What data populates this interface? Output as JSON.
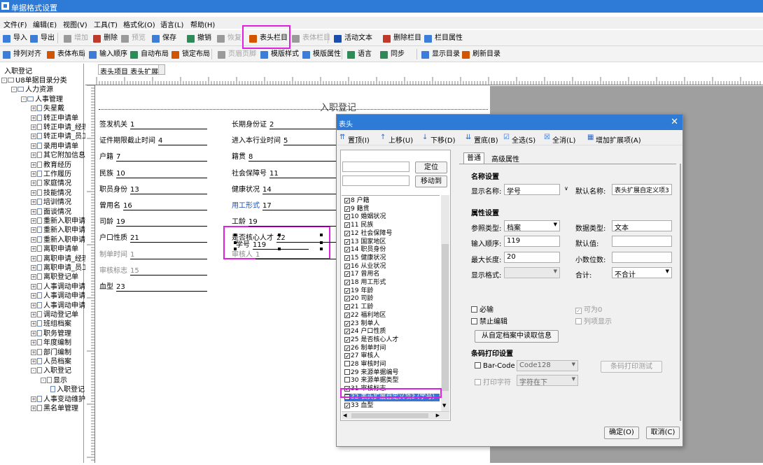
{
  "window": {
    "title": "单据格式设置"
  },
  "menu": [
    "文件(F)",
    "编辑(E)",
    "视图(V)",
    "工具(T)",
    "格式化(O)",
    "语言(L)",
    "帮助(H)"
  ],
  "toolbar1": [
    {
      "label": "导入",
      "icon": "import-icon",
      "color": "#3b7dd8",
      "enabled": true
    },
    {
      "label": "导出",
      "icon": "export-icon",
      "color": "#3b7dd8",
      "enabled": true
    },
    {
      "label": "增加",
      "icon": "add-icon",
      "color": "#9a9a9a",
      "enabled": false
    },
    {
      "label": "删除",
      "icon": "delete-icon",
      "color": "#c0392b",
      "enabled": true
    },
    {
      "label": "预览",
      "icon": "preview-icon",
      "color": "#9a9a9a",
      "enabled": false
    },
    {
      "label": "保存",
      "icon": "save-icon",
      "color": "#3b7dd8",
      "enabled": true
    },
    {
      "label": "撤销",
      "icon": "undo-icon",
      "color": "#2e8b57",
      "enabled": true
    },
    {
      "label": "恢复",
      "icon": "redo-icon",
      "color": "#9a9a9a",
      "enabled": false
    },
    {
      "label": "表头栏目",
      "icon": "header-column-icon",
      "color": "#d35400",
      "enabled": true
    },
    {
      "label": "表体栏目",
      "icon": "body-column-icon",
      "color": "#9a9a9a",
      "enabled": false
    },
    {
      "label": "活动文本",
      "icon": "active-text-icon",
      "color": "#1a4fb0",
      "enabled": true
    },
    {
      "label": "删除栏目",
      "icon": "delete-column-icon",
      "color": "#c0392b",
      "enabled": true
    },
    {
      "label": "栏目属性",
      "icon": "column-property-icon",
      "color": "#3b7dd8",
      "enabled": true
    }
  ],
  "toolbar2": [
    {
      "label": "排列对齐",
      "icon": "align-icon",
      "color": "#3b7dd8",
      "enabled": true
    },
    {
      "label": "表体布局",
      "icon": "body-layout-icon",
      "color": "#d35400",
      "enabled": true
    },
    {
      "label": "输入顺序",
      "icon": "input-order-icon",
      "color": "#3b7dd8",
      "enabled": true
    },
    {
      "label": "自动布局",
      "icon": "auto-layout-icon",
      "color": "#2e8b57",
      "enabled": true
    },
    {
      "label": "锁定布局",
      "icon": "lock-layout-icon",
      "color": "#d35400",
      "enabled": true
    },
    {
      "label": "页眉页脚",
      "icon": "header-footer-icon",
      "color": "#9a9a9a",
      "enabled": false
    },
    {
      "label": "模版样式",
      "icon": "template-style-icon",
      "color": "#3b7dd8",
      "enabled": true
    },
    {
      "label": "模版属性",
      "icon": "template-property-icon",
      "color": "#3b7dd8",
      "enabled": true
    },
    {
      "label": "语言",
      "icon": "language-icon",
      "color": "#2e8b57",
      "enabled": true
    },
    {
      "label": "同步",
      "icon": "sync-icon",
      "color": "#2e8b57",
      "enabled": true
    },
    {
      "label": "显示目录",
      "icon": "show-catalog-icon",
      "color": "#3b7dd8",
      "enabled": true
    },
    {
      "label": "刷新目录",
      "icon": "refresh-catalog-icon",
      "color": "#d35400",
      "enabled": true
    }
  ],
  "left_pane": {
    "title": "入职登记",
    "tree": [
      {
        "label": "U8单据目录分类",
        "depth": 0,
        "type": "folder",
        "exp": "-"
      },
      {
        "label": "人力资源",
        "depth": 1,
        "type": "folder",
        "exp": "-"
      },
      {
        "label": "人事管理",
        "depth": 2,
        "type": "folder",
        "exp": "-"
      },
      {
        "label": "失星戴",
        "depth": 3,
        "type": "doc",
        "exp": "+"
      },
      {
        "label": "转正申请单",
        "depth": 3,
        "type": "doc",
        "exp": "+"
      },
      {
        "label": "转正申请_经理",
        "depth": 3,
        "type": "doc",
        "exp": "+"
      },
      {
        "label": "转正申请_员工",
        "depth": 3,
        "type": "doc",
        "exp": "+"
      },
      {
        "label": "录用申请单",
        "depth": 3,
        "type": "doc",
        "exp": "+"
      },
      {
        "label": "其它附加信息",
        "depth": 3,
        "type": "doc",
        "exp": "+"
      },
      {
        "label": "教育经历",
        "depth": 3,
        "type": "doc",
        "exp": "+"
      },
      {
        "label": "工作履历",
        "depth": 3,
        "type": "doc",
        "exp": "+"
      },
      {
        "label": "家庭情况",
        "depth": 3,
        "type": "doc",
        "exp": "+"
      },
      {
        "label": "技能情况",
        "depth": 3,
        "type": "doc",
        "exp": "+"
      },
      {
        "label": "培训情况",
        "depth": 3,
        "type": "doc",
        "exp": "+"
      },
      {
        "label": "面谈情况",
        "depth": 3,
        "type": "doc",
        "exp": "+"
      },
      {
        "label": "重新入职申请单",
        "depth": 3,
        "type": "doc",
        "exp": "+"
      },
      {
        "label": "重新入职申请单",
        "depth": 3,
        "type": "doc",
        "exp": "+"
      },
      {
        "label": "重新入职申请单",
        "depth": 3,
        "type": "doc",
        "exp": "+"
      },
      {
        "label": "离职申请单",
        "depth": 3,
        "type": "doc",
        "exp": "+"
      },
      {
        "label": "离职申请_经理",
        "depth": 3,
        "type": "doc",
        "exp": "+"
      },
      {
        "label": "离职申请_员工",
        "depth": 3,
        "type": "doc",
        "exp": "+"
      },
      {
        "label": "离职登记单",
        "depth": 3,
        "type": "doc",
        "exp": "+"
      },
      {
        "label": "人事调动申请单",
        "depth": 3,
        "type": "doc",
        "exp": "+"
      },
      {
        "label": "人事调动申请单",
        "depth": 3,
        "type": "doc",
        "exp": "+"
      },
      {
        "label": "人事调动申请单",
        "depth": 3,
        "type": "doc",
        "exp": "+"
      },
      {
        "label": "调动登记单",
        "depth": 3,
        "type": "doc",
        "exp": "+"
      },
      {
        "label": "班组档案",
        "depth": 3,
        "type": "doc",
        "exp": "+"
      },
      {
        "label": "职务管理",
        "depth": 3,
        "type": "doc",
        "exp": "+"
      },
      {
        "label": "年度编制",
        "depth": 3,
        "type": "doc",
        "exp": "+"
      },
      {
        "label": "部门编制",
        "depth": 3,
        "type": "doc",
        "exp": "+"
      },
      {
        "label": "人员档案",
        "depth": 3,
        "type": "doc",
        "exp": "+"
      },
      {
        "label": "入职登记",
        "depth": 3,
        "type": "doc",
        "exp": "-"
      },
      {
        "label": "显示",
        "depth": 4,
        "type": "doc",
        "exp": "-"
      },
      {
        "label": "入职登记",
        "depth": 5,
        "type": "doc",
        "exp": ""
      },
      {
        "label": "人事变动维护",
        "depth": 3,
        "type": "doc",
        "exp": "+"
      },
      {
        "label": "黑名单管理",
        "depth": 3,
        "type": "doc",
        "exp": "+"
      }
    ]
  },
  "header_select": "表头项目 表头扩展自定",
  "doc": {
    "title": "入职登记",
    "fields": [
      {
        "label": "签发机关",
        "value": "1",
        "col": 0,
        "row": 0
      },
      {
        "label": "证件期限截止时间",
        "value": "4",
        "col": 0,
        "row": 1
      },
      {
        "label": "户籍",
        "value": "7",
        "col": 0,
        "row": 2
      },
      {
        "label": "民族",
        "value": "10",
        "col": 0,
        "row": 3
      },
      {
        "label": "职员身份",
        "value": "13",
        "col": 0,
        "row": 4
      },
      {
        "label": "曾用名",
        "value": "16",
        "col": 0,
        "row": 5
      },
      {
        "label": "司龄",
        "value": "19",
        "col": 0,
        "row": 6
      },
      {
        "label": "户口性质",
        "value": "21",
        "col": 0,
        "row": 7
      },
      {
        "label": "制单时间",
        "value": "1",
        "col": 0,
        "row": 8,
        "dim": true
      },
      {
        "label": "审核标志",
        "value": "15",
        "col": 0,
        "row": 9,
        "dim": true
      },
      {
        "label": "血型",
        "value": "23",
        "col": 0,
        "row": 10
      },
      {
        "label": "长期身份证",
        "value": "2",
        "col": 1,
        "row": 0
      },
      {
        "label": "进入本行业时间",
        "value": "5",
        "col": 1,
        "row": 1
      },
      {
        "label": "籍贯",
        "value": "8",
        "col": 1,
        "row": 2
      },
      {
        "label": "社会保障号",
        "value": "11",
        "col": 1,
        "row": 3
      },
      {
        "label": "健康状况",
        "value": "14",
        "col": 1,
        "row": 4
      },
      {
        "label": "用工形式",
        "value": "17",
        "col": 1,
        "row": 5,
        "blue": true
      },
      {
        "label": "工龄",
        "value": "19",
        "col": 1,
        "row": 6
      },
      {
        "label": "是否核心人才",
        "value": "22",
        "col": 1,
        "row": 7
      },
      {
        "label": "审核人",
        "value": "1",
        "col": 1,
        "row": 8,
        "dim": true
      }
    ],
    "selected_field": {
      "label": "学号",
      "value": "119"
    }
  },
  "dialog": {
    "title": "表头",
    "toolbar": [
      {
        "label": "置顶(I)",
        "icon": "top-icon",
        "glyph": "⇈"
      },
      {
        "label": "上移(U)",
        "icon": "up-icon",
        "glyph": "↑"
      },
      {
        "label": "下移(D)",
        "icon": "down-icon",
        "glyph": "↓"
      },
      {
        "label": "置底(B)",
        "icon": "bottom-icon",
        "glyph": "⇊"
      },
      {
        "label": "全选(S)",
        "icon": "select-all-icon",
        "glyph": "☑"
      },
      {
        "label": "全消(L)",
        "icon": "clear-all-icon",
        "glyph": "☒"
      },
      {
        "label": "增加扩展项(A)",
        "icon": "add-extension-icon",
        "glyph": "▦"
      }
    ],
    "locate_btn": "定位",
    "move_btn": "移动到",
    "list": [
      {
        "label": "8 户籍",
        "checked": true
      },
      {
        "label": "9 籍贯",
        "checked": true
      },
      {
        "label": "10 婚姻状况",
        "checked": true
      },
      {
        "label": "11 民族",
        "checked": true
      },
      {
        "label": "12 社会保障号",
        "checked": true
      },
      {
        "label": "13 国家地区",
        "checked": true
      },
      {
        "label": "14 职员身份",
        "checked": true
      },
      {
        "label": "15 健康状况",
        "checked": true
      },
      {
        "label": "16 从业状况",
        "checked": true
      },
      {
        "label": "17 曾用名",
        "checked": true
      },
      {
        "label": "18 用工形式",
        "checked": true
      },
      {
        "label": "19 年龄",
        "checked": true
      },
      {
        "label": "20 司龄",
        "checked": true
      },
      {
        "label": "21 工龄",
        "checked": true
      },
      {
        "label": "22 福利地区",
        "checked": true
      },
      {
        "label": "23 制单人",
        "checked": true
      },
      {
        "label": "24 户口性质",
        "checked": true
      },
      {
        "label": "25 是否核心人才",
        "checked": true
      },
      {
        "label": "26 制单时间",
        "checked": true
      },
      {
        "label": "27 审核人",
        "checked": true
      },
      {
        "label": "28 审核时间",
        "checked": false
      },
      {
        "label": "29 来源单据编号",
        "checked": false
      },
      {
        "label": "30 来源单据类型",
        "checked": false
      },
      {
        "label": "31 审核标志",
        "checked": true
      },
      {
        "label": "32 表头扩展自定义项3 (学号)",
        "checked": true,
        "selected": true
      },
      {
        "label": "33 血型",
        "checked": true
      }
    ],
    "tabs": [
      "普通",
      "高级属性"
    ],
    "name_section": "名称设置",
    "display_name_label": "显示名称:",
    "display_name": "学号",
    "default_name_label": "默认名称:",
    "default_name": "表头扩展自定义项3",
    "prop_section": "属性设置",
    "ref_type_label": "参照类型:",
    "ref_type": "档案",
    "data_type_label": "数据类型:",
    "data_type": "文本",
    "input_order_label": "输入顺序:",
    "input_order": "119",
    "default_value_label": "默认值:",
    "default_value": "",
    "max_len_label": "最大长度:",
    "max_len": "20",
    "decimals_label": "小数位数:",
    "decimals": "",
    "display_fmt_label": "显示格式:",
    "display_fmt": "",
    "total_label": "合计:",
    "total": "不合计",
    "required_label": "必输",
    "can_zero_label": "可为0",
    "no_edit_label": "禁止编辑",
    "list_show_label": "列项显示",
    "read_from_archive": "从自定档案中读取信息",
    "barcode_section": "条码打印设置",
    "barcode_label": "Bar-Code",
    "barcode_type": "Code128",
    "print_char_label": "打印字符",
    "print_char_pos": "字符在下",
    "barcode_test": "条码打印测试",
    "ok": "确定(O)",
    "cancel": "取消(C)"
  }
}
